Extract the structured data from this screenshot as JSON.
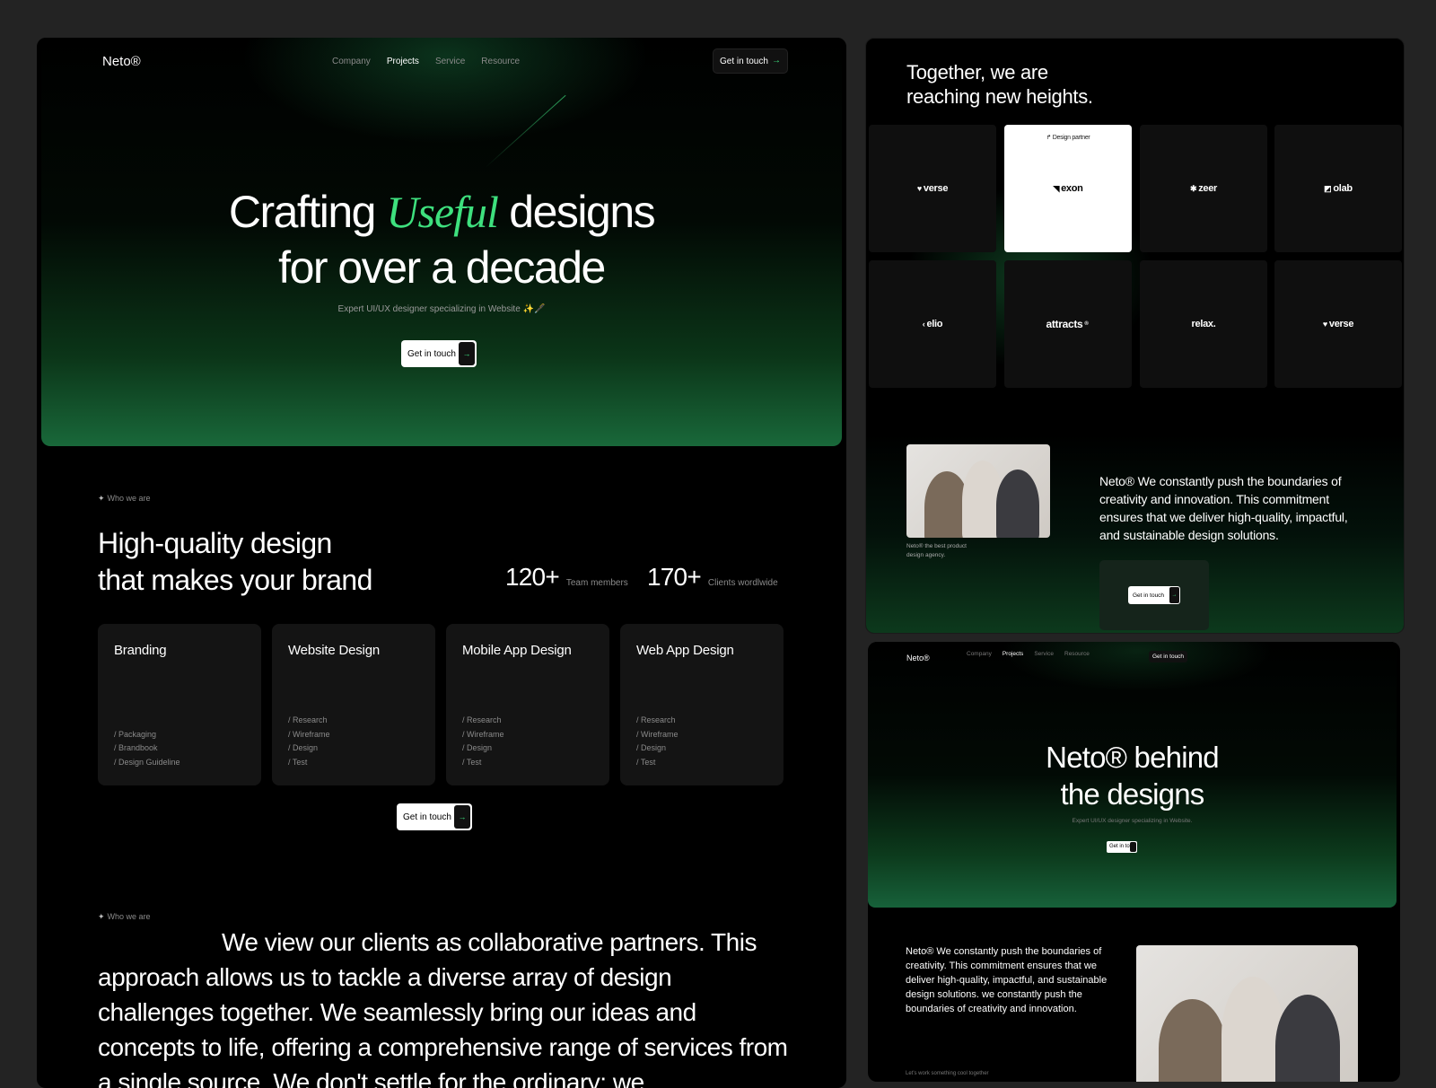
{
  "left": {
    "nav": {
      "logo": "Neto®",
      "links": [
        "Company",
        "Projects",
        "Service",
        "Resource"
      ],
      "cta": "Get in touch"
    },
    "hero": {
      "title_pre": "Crafting",
      "title_accent": "Useful",
      "title_post": "designs",
      "title_line2": "for over a decade",
      "subtitle": "Expert UI/UX designer specializing in Website ✨🖋️",
      "cta": "Get in touch"
    },
    "who": {
      "label": "Who we are",
      "title_line1": "High-quality design",
      "title_line2": "that makes your brand",
      "stats": [
        {
          "value": "120+",
          "caption": "Team members"
        },
        {
          "value": "170+",
          "caption": "Clients wordlwide"
        }
      ]
    },
    "services": [
      {
        "title": "Branding",
        "items": [
          "/ Packaging",
          "/ Brandbook",
          "/ Design Guideline"
        ]
      },
      {
        "title": "Website Design",
        "items": [
          "/ Research",
          "/ Wireframe",
          "/ Design",
          "/ Test"
        ]
      },
      {
        "title": "Mobile App Design",
        "items": [
          "/ Research",
          "/ Wireframe",
          "/ Design",
          "/ Test"
        ]
      },
      {
        "title": "Web App Design",
        "items": [
          "/ Research",
          "/ Wireframe",
          "/ Design",
          "/ Test"
        ]
      }
    ],
    "services_cta": "Get in touch",
    "about": {
      "label": "Who we are",
      "text": "We view our clients as collaborative partners. This approach allows us to tackle a diverse array of design challenges together. We seamlessly bring our ideas and concepts to life, offering a comprehensive range of services from a single source. We don't settle for the ordinary; we"
    }
  },
  "right_top": {
    "title_line1": "Together, we are",
    "title_line2": "reaching new heights.",
    "logos": [
      {
        "name": "verse",
        "mark": "♥"
      },
      {
        "name": "exon",
        "mark": "◥",
        "tag": "↱ Design partner"
      },
      {
        "name": "zeer",
        "mark": "✱"
      },
      {
        "name": "olab",
        "mark": "◩"
      },
      {
        "name": "elio",
        "mark": "‹"
      },
      {
        "name": "attracts",
        "mark": "®"
      },
      {
        "name": "relax.",
        "mark": ""
      },
      {
        "name": "verse",
        "mark": "♥"
      }
    ],
    "caption": "Neto® the best product design agency.",
    "text": "Neto® We constantly push the boundaries of creativity and innovation. This commitment ensures that we deliver high-quality, impactful, and sustainable design solutions.",
    "cta": "Get in touch"
  },
  "right_bottom": {
    "nav": {
      "logo": "Neto®",
      "links": [
        "Company",
        "Projects",
        "Service",
        "Resource"
      ],
      "cta": "Get in touch"
    },
    "title_line1": "Neto® behind",
    "title_line2": "the designs",
    "subtitle": "Expert UI/UX designer specializing in Website.",
    "cta": "Get in to",
    "text": "Neto® We constantly push the boundaries of creativity. This commitment ensures that we deliver high-quality, impactful, and sustainable design solutions. we constantly push the boundaries of creativity and innovation.",
    "footer": "Let's work something cool together"
  },
  "colors": {
    "accent": "#3ee07e",
    "background": "#000000",
    "page": "#232323"
  }
}
